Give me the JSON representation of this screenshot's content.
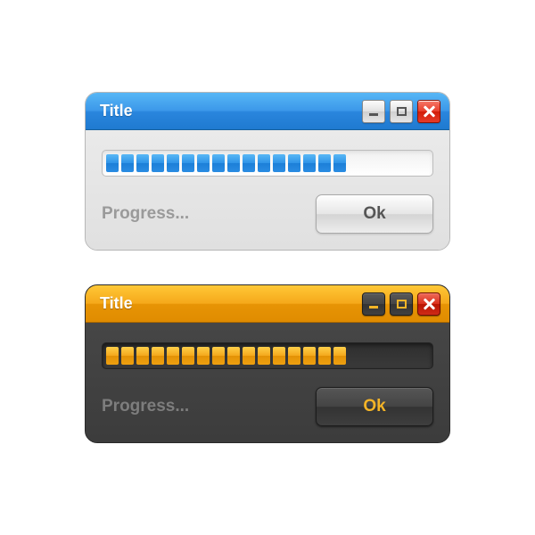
{
  "dialogs": {
    "light": {
      "title": "Title",
      "status": "Progress...",
      "ok_label": "Ok",
      "progress_segments": 16,
      "accent": "#2a8ce2"
    },
    "dark": {
      "title": "Title",
      "status": "Progress...",
      "ok_label": "Ok",
      "progress_segments": 16,
      "accent": "#eea010"
    }
  }
}
